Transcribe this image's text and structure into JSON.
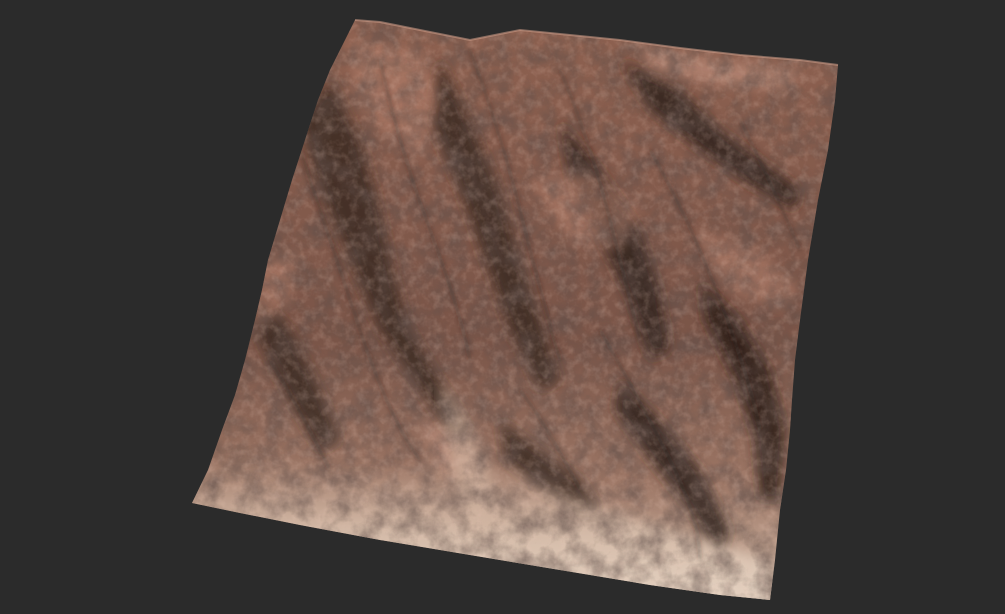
{
  "viewport": {
    "background_color": "#2b2b2b"
  },
  "terrain": {
    "palette": {
      "rock_dark": "#3a2a24",
      "rock_mid": "#7a5548",
      "rock_light": "#b98470",
      "sand": "#d9c1ae",
      "sand_light": "#e7d6c6",
      "shadow": "#1e1512"
    }
  }
}
